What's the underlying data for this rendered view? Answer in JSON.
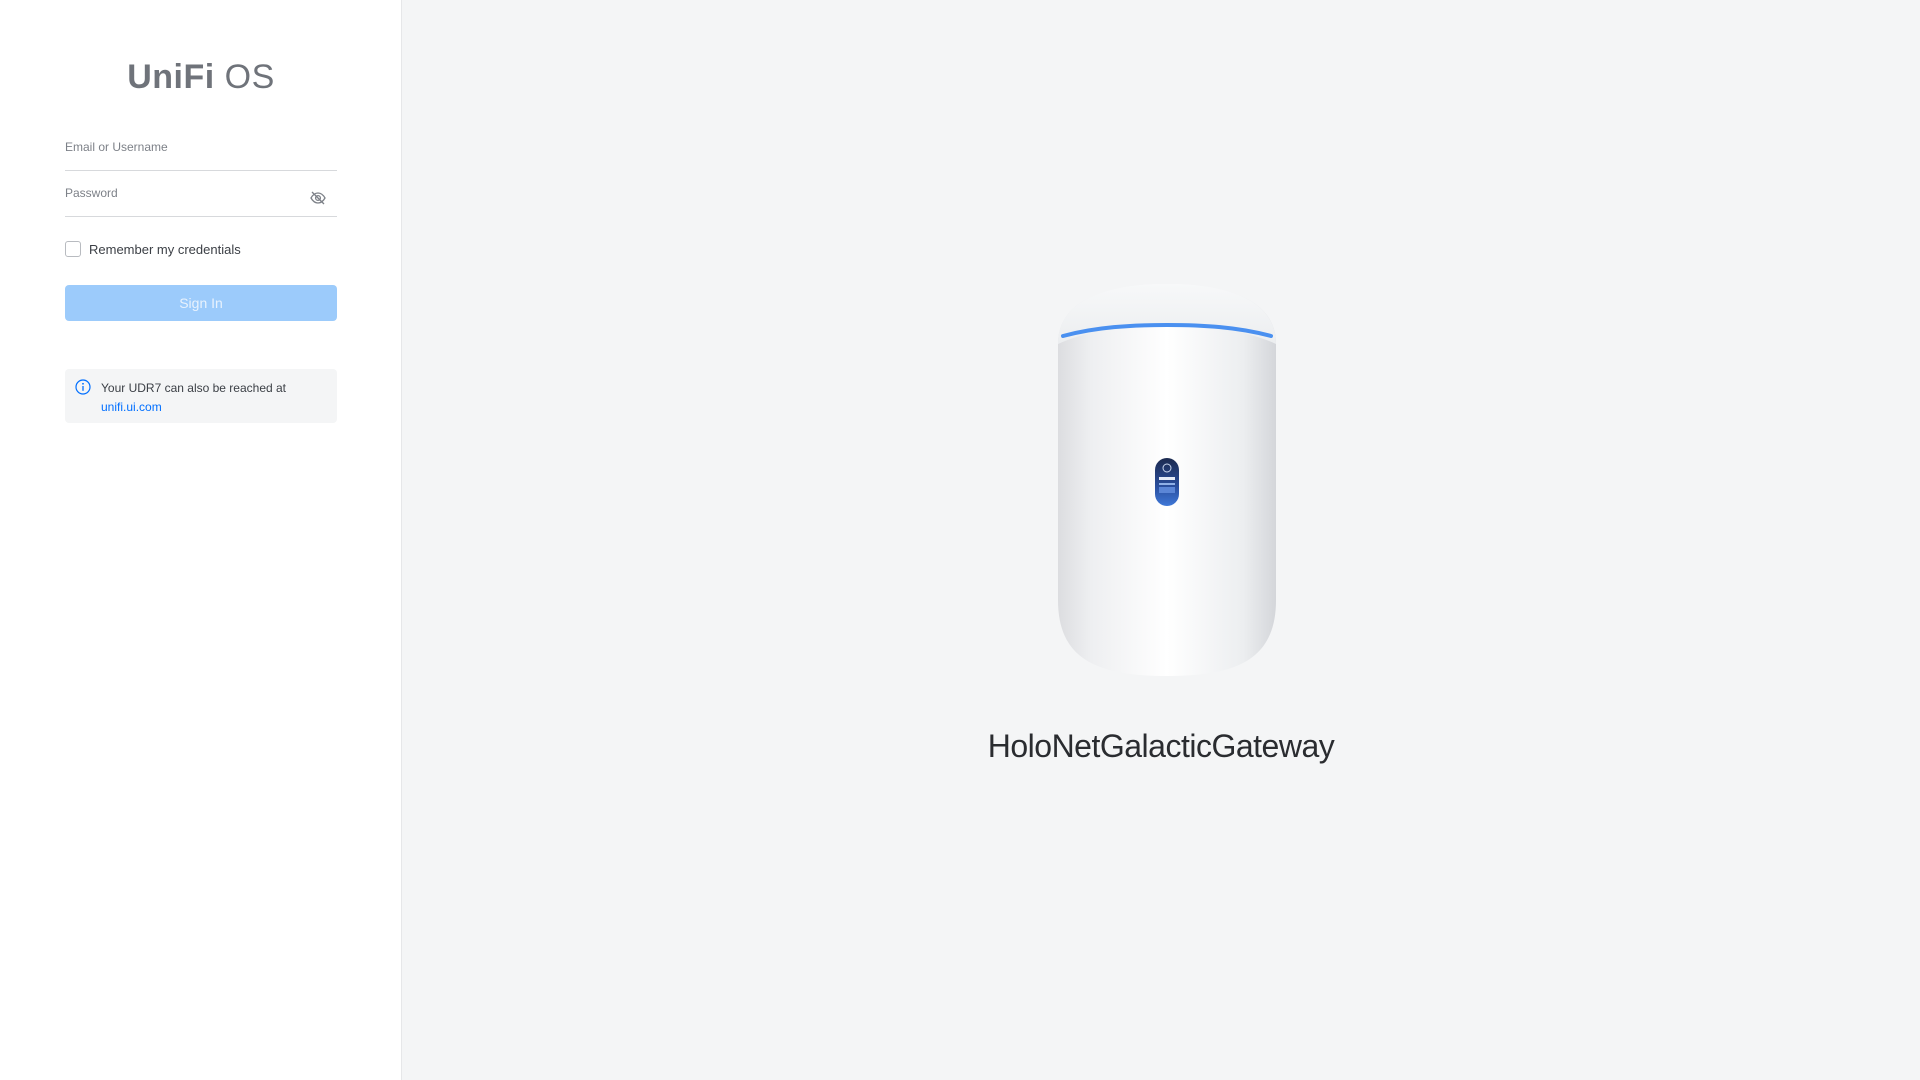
{
  "logo": {
    "strong": "UniFi",
    "light": "OS"
  },
  "login": {
    "username_label": "Email or Username",
    "username_value": "",
    "password_label": "Password",
    "password_value": "",
    "remember_label": "Remember my credentials",
    "remember_checked": false,
    "signin_label": "Sign In"
  },
  "notice": {
    "text": "Your UDR7 can also be reached at",
    "link": "unifi.ui.com"
  },
  "device": {
    "name": "HoloNetGalacticGateway"
  },
  "colors": {
    "accent": "#006fff",
    "signin_disabled": "#9ccbfb",
    "device_ring": "#4a90f0"
  }
}
